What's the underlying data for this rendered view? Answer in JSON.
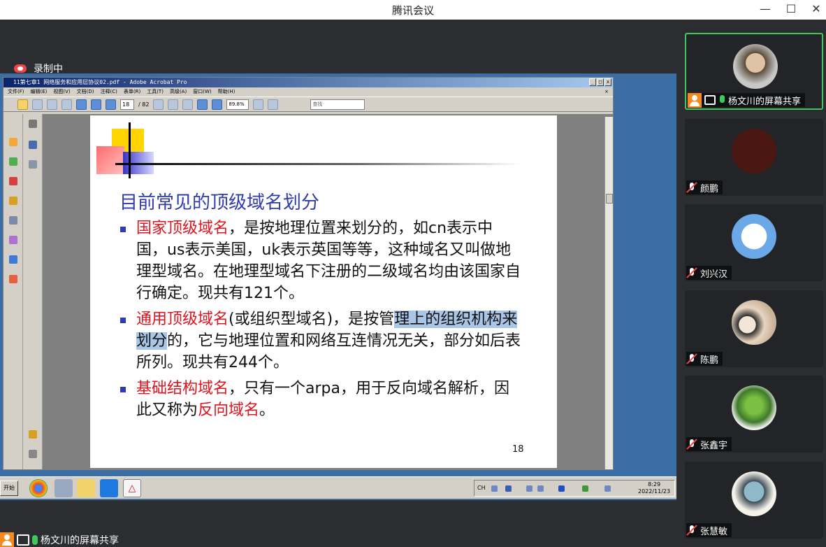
{
  "app": {
    "title": "腾讯会议",
    "recording_label": "录制中"
  },
  "acrobat": {
    "window_title": "11第七章1 网络服务和应用层协议02.pdf - Adobe Acrobat Pro",
    "menu": [
      "文件(F)",
      "编辑(E)",
      "视图(V)",
      "文档(D)",
      "注释(C)",
      "表单(R)",
      "工具(T)",
      "高级(A)",
      "窗口(W)",
      "帮助(H)"
    ],
    "current_page": "18",
    "total_pages": "/ 82",
    "zoom": "89.8%",
    "find_placeholder": "查找"
  },
  "slide": {
    "title": "目前常见的顶级域名划分",
    "b1_term": "国家顶级域名",
    "b1_text": "，是按地理位置来划分的，如cn表示中国，us表示美国，uk表示英国等等，这种域名又叫做地理型域名。在地理型域名下注册的二级域名均由该国家自行确定。现共有121个。",
    "b2_term": "通用顶级域名",
    "b2_text_a": "(或组织型域名)，是按管",
    "b2_highlight": "理上的组织机构来划分",
    "b2_text_b": "的，它与地理位置和网络互连情况无关，部分如后表所列。现共有244个。",
    "b3_term": "基础结构域名",
    "b3_text": "，只有一个arpa，用于反向域名解析，因此又称为",
    "b3_term2": "反向域名",
    "b3_end": "。",
    "page_number": "18"
  },
  "taskbar": {
    "start_label": "开始",
    "lang": "CH",
    "time": "8:29",
    "date": "2022/11/23"
  },
  "share_bar": {
    "label": "杨文川的屏幕共享"
  },
  "participants": [
    {
      "name": "杨文川的屏幕共享",
      "active": true
    },
    {
      "name": "颜鹏"
    },
    {
      "name": "刘兴汉"
    },
    {
      "name": "陈鹏"
    },
    {
      "name": "张鑫宇"
    },
    {
      "name": "张慧敏"
    }
  ],
  "colors": {
    "mic_green": "#3ec85a",
    "mute_red": "#f04545",
    "slide_title_blue": "#2e3cb0",
    "slide_red": "#e0141e"
  }
}
